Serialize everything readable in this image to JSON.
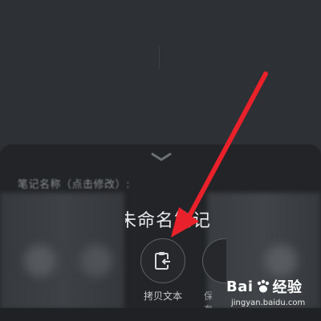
{
  "sheet": {
    "note_name_label": "笔记名称（点击修改）:",
    "title": "未命名笔记"
  },
  "share_actions": [
    {
      "label": "拷贝文本",
      "icon": "clipboard-arrow-icon"
    },
    {
      "label": "保存",
      "icon": "unknown-icon"
    }
  ],
  "watermark": {
    "logo_text_1": "Bai",
    "logo_text_2": "经验",
    "url": "jingyan.baidu.com"
  },
  "colors": {
    "arrow": "#e8212a",
    "background": "#2c2f33",
    "sheet": "#222427"
  }
}
